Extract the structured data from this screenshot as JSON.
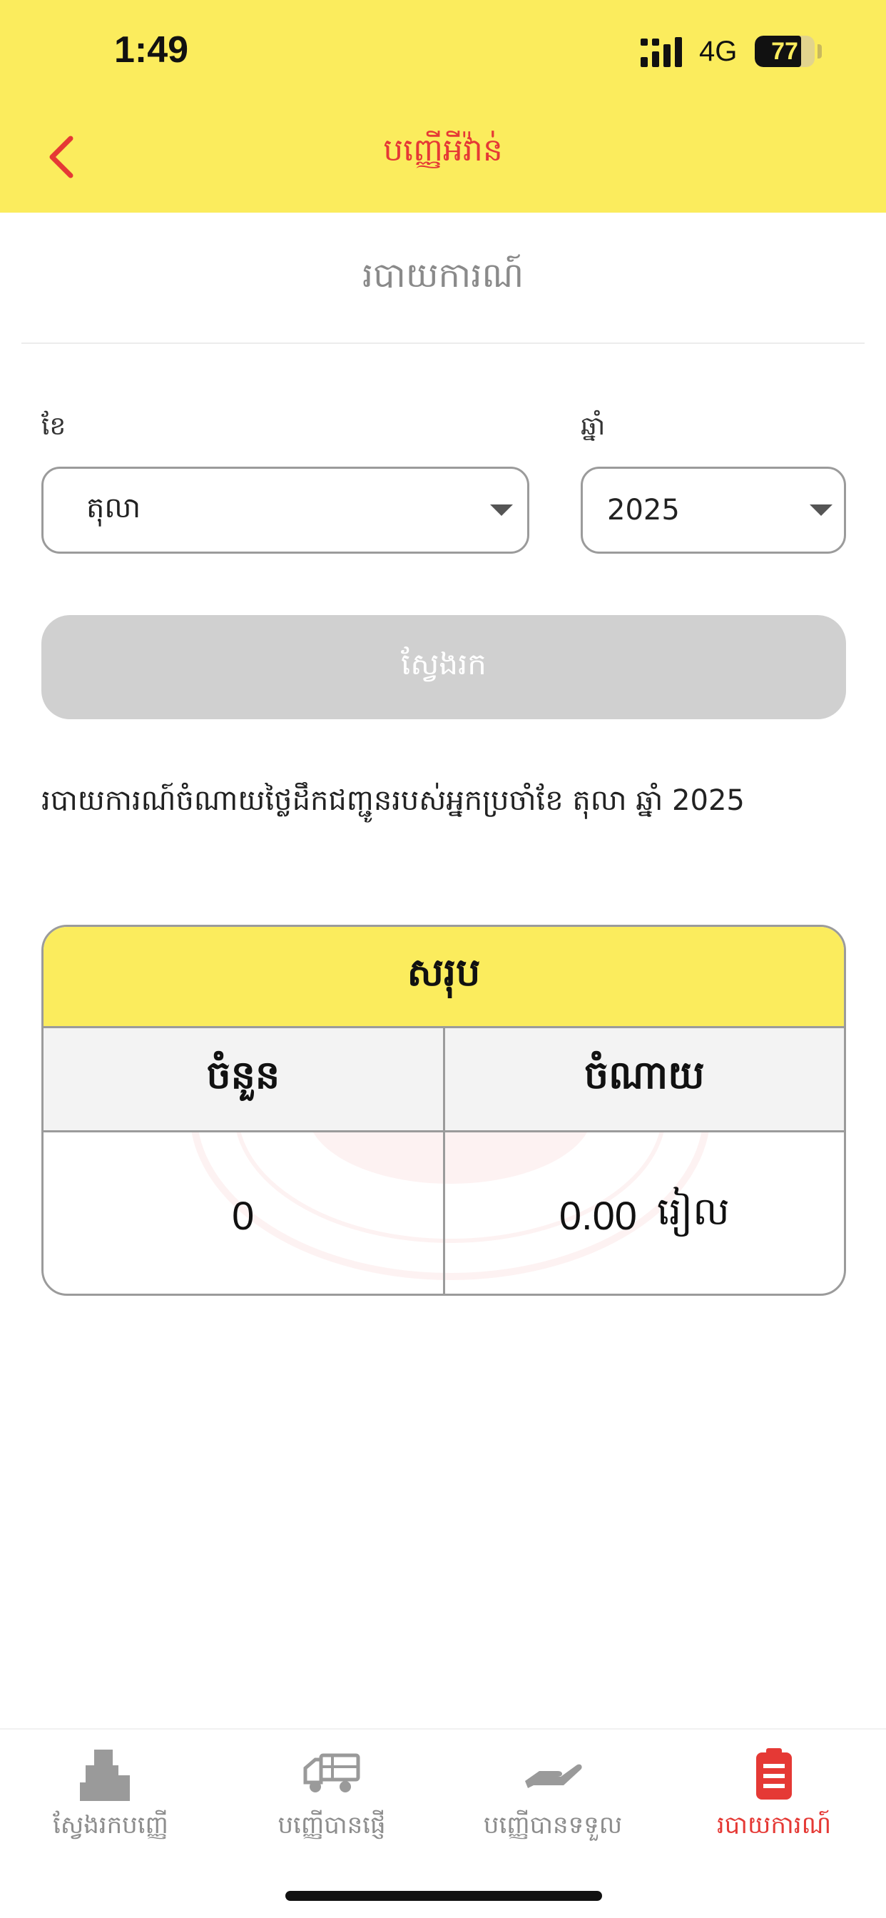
{
  "status_bar": {
    "time": "1:49",
    "network": "4G",
    "battery_level": "77",
    "battery_fraction": 0.77
  },
  "header": {
    "title": "បញ្ញើអីវ៉ាន់",
    "background_color": "#fbec5d",
    "accent_color": "#e53935"
  },
  "section": {
    "title": "របាយការណ៍"
  },
  "filters": {
    "month_label": "ខែ",
    "month_value": "តុលា",
    "year_label": "ឆ្នាំ",
    "year_value": "2025",
    "search_label": "ស្វែងរក"
  },
  "report": {
    "description": "របាយការណ៍ចំណាយថ្លៃដឹកជញ្ជូនរបស់អ្នកប្រចាំខែ តុលា ឆ្នាំ 2025"
  },
  "summary": {
    "title": "សរុប",
    "col_count_label": "ចំនួន",
    "col_expense_label": "ចំណាយ",
    "count_value": "0",
    "expense_value": "0.00",
    "currency": "រៀល"
  },
  "tabbar": {
    "items": [
      {
        "label": "ស្វែងរកបញ្ញើ",
        "icon": "boxes-icon",
        "active": false
      },
      {
        "label": "បញ្ញើបានផ្ញើ",
        "icon": "truck-icon",
        "active": false
      },
      {
        "label": "បញ្ញើបានទទួល",
        "icon": "hand-receive-icon",
        "active": false
      },
      {
        "label": "របាយការណ៍",
        "icon": "clipboard-icon",
        "active": true
      }
    ]
  }
}
